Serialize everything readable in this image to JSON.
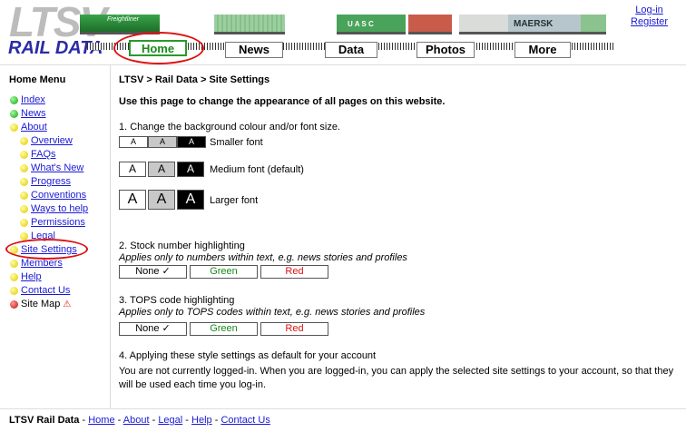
{
  "header": {
    "logo_big": "LTSV",
    "logo_sub": "RAIL DATA",
    "wagon_labels": [
      "Freightliner",
      "",
      "U A S C",
      "",
      "MAERSK",
      ""
    ],
    "nav": [
      {
        "label": "Home",
        "active": true
      },
      {
        "label": "News",
        "active": false
      },
      {
        "label": "Data",
        "active": false
      },
      {
        "label": "Photos",
        "active": false
      },
      {
        "label": "More",
        "active": false
      }
    ],
    "login_label": "Log-in",
    "register_label": "Register"
  },
  "sidebar": {
    "title": "Home Menu",
    "items": [
      {
        "label": "Index",
        "dot": "green",
        "level": 0
      },
      {
        "label": "News",
        "dot": "green",
        "level": 0
      },
      {
        "label": "About",
        "dot": "yellow",
        "level": 0
      },
      {
        "label": "Overview",
        "dot": "yellow",
        "level": 1
      },
      {
        "label": "FAQs",
        "dot": "yellow",
        "level": 1
      },
      {
        "label": "What's New",
        "dot": "yellow",
        "level": 1
      },
      {
        "label": "Progress",
        "dot": "yellow",
        "level": 1
      },
      {
        "label": "Conventions",
        "dot": "yellow",
        "level": 1
      },
      {
        "label": "Ways to help",
        "dot": "yellow",
        "level": 1
      },
      {
        "label": "Permissions",
        "dot": "yellow",
        "level": 1
      },
      {
        "label": "Legal",
        "dot": "yellow",
        "level": 1
      },
      {
        "label": "Site Settings",
        "dot": "yellow",
        "level": 0
      },
      {
        "label": "Members",
        "dot": "yellow",
        "level": 0
      },
      {
        "label": "Help",
        "dot": "yellow",
        "level": 0
      },
      {
        "label": "Contact Us",
        "dot": "yellow",
        "level": 0
      },
      {
        "label": "Site Map",
        "dot": "red",
        "level": 0
      }
    ]
  },
  "main": {
    "breadcrumb": "LTSV > Rail Data > Site Settings",
    "intro": "Use this page to change the appearance of all pages on this website.",
    "section1_title": "1. Change the background colour and/or font size.",
    "font_button_label": "A",
    "font_sizes": [
      {
        "label": "Smaller font"
      },
      {
        "label": "Medium font (default)"
      },
      {
        "label": "Larger font"
      }
    ],
    "section2_title": "2. Stock number highlighting",
    "section2_note": "Applies only to numbers within text, e.g. news stories and profiles",
    "section3_title": "3. TOPS code highlighting",
    "section3_note": "Applies only to TOPS codes within text, e.g. news stories and profiles",
    "highlight_options": [
      "None ✓",
      "Green",
      "Red"
    ],
    "section4_title": "4. Applying these style settings as default for your account",
    "section4_text": "You are not currently logged-in. When you are logged-in, you can apply the selected site settings to your account, so that they will be used each time you log-in."
  },
  "footer": {
    "brand": "LTSV Rail Data",
    "links": [
      "Home",
      "About",
      "Legal",
      "Help",
      "Contact Us"
    ]
  },
  "colors": {
    "link": "#1a1ad6",
    "logo_blue": "#2b2ba8",
    "active_tab_green": "#1a8a1a",
    "highlight_red": "#d11111"
  }
}
